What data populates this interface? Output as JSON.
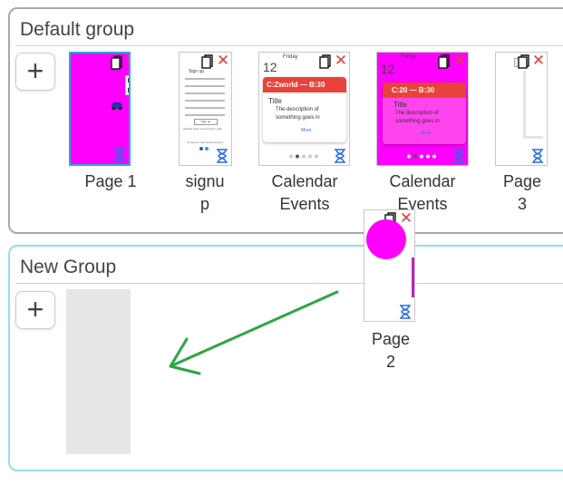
{
  "groups": {
    "default": {
      "title": "Default group",
      "add_label": "+",
      "pages": [
        {
          "label": "Page 1",
          "selected": true
        },
        {
          "label": "signu\np"
        },
        {
          "label": "Calendar\nEvents"
        },
        {
          "label": "Calendar\nEvents"
        },
        {
          "label": "Page\n3"
        }
      ]
    },
    "new": {
      "title": "New Group",
      "add_label": "+"
    }
  },
  "dragging_page": {
    "label": "Page\n2"
  },
  "thumb_text": {
    "calendar_day": "12",
    "calendar_weekday": "Friday",
    "calendar_header_a": "C:Zworld — B:30",
    "calendar_header_b": "C:20 — B:30",
    "calendar_title": "Title",
    "calendar_desc_line1": "The description of",
    "calendar_desc_line2": "something goes in",
    "calendar_more": "More",
    "signup_title": "Sign up",
    "signup_link": "Already have an account? Login",
    "signup_button": "Sign up",
    "signup_social": "Or sign up with social account"
  },
  "colors": {
    "magenta": "#ff00ff",
    "calendar_red": "#e8423a",
    "selection_border": "#2aa8d8",
    "new_group_border": "#93dfee",
    "drag_arrow": "#2aa840",
    "close_red": "#e0403d",
    "hourglass_blue": "#2c6be0"
  }
}
